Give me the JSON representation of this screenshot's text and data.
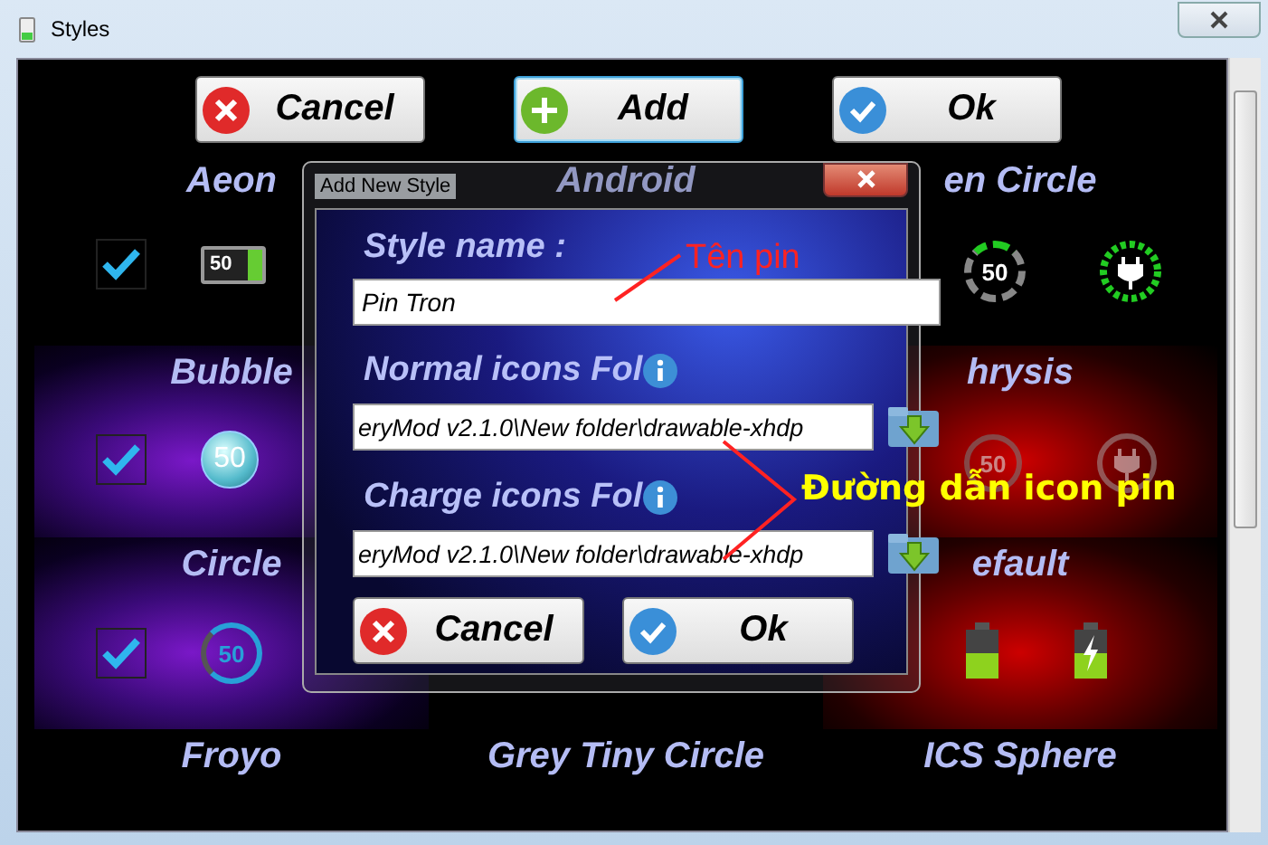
{
  "window": {
    "title": "Styles"
  },
  "toolbar": [
    {
      "label": "Cancel",
      "kind": "cancel",
      "selected": false
    },
    {
      "label": "Add",
      "kind": "add",
      "selected": true
    },
    {
      "label": "Ok",
      "kind": "ok",
      "selected": false
    }
  ],
  "columns": [
    [
      {
        "title": "Aeon",
        "checked": true,
        "icons": [
          {
            "kind": "battery",
            "text": "50"
          }
        ]
      },
      {
        "title": "Bubble",
        "checked": true,
        "kind": "purple",
        "icons": [
          {
            "kind": "bubble",
            "text": "50"
          }
        ]
      },
      {
        "title": "Circle",
        "checked": true,
        "kind": "purple",
        "icons": [
          {
            "kind": "ring",
            "text": "50"
          }
        ]
      },
      {
        "title": "Froyo"
      }
    ],
    [
      {
        "title": "Android"
      },
      {
        "title": "Grey Tiny Circle"
      }
    ],
    [
      {
        "title": "en Circle",
        "icons": [
          {
            "kind": "dashed-ring",
            "text": "50"
          },
          {
            "kind": "plug-ring"
          }
        ]
      },
      {
        "title": "hrysis",
        "kind": "red",
        "icons": [
          {
            "kind": "faded-ring",
            "text": "50"
          },
          {
            "kind": "faded-plug"
          }
        ]
      },
      {
        "title": "efault",
        "kind": "red",
        "icons": [
          {
            "kind": "green-battery"
          },
          {
            "kind": "charge-battery"
          }
        ]
      },
      {
        "title": "ICS Sphere"
      }
    ]
  ],
  "dialog": {
    "title": "Add New Style",
    "name_label": "Style name :",
    "name_value": "Pin Tron",
    "normal_label": "Normal icons Fol",
    "normal_value": "eryMod v2.1.0\\New folder\\drawable-xhdp",
    "charge_label": "Charge icons Fol",
    "charge_value": "eryMod v2.1.0\\New folder\\drawable-xhdp",
    "buttons": [
      {
        "label": "Cancel",
        "kind": "cancel"
      },
      {
        "label": "Ok",
        "kind": "ok"
      }
    ]
  },
  "annotations": {
    "name_note": "Tên pin",
    "path_note": "Đường dẫn icon pin"
  }
}
